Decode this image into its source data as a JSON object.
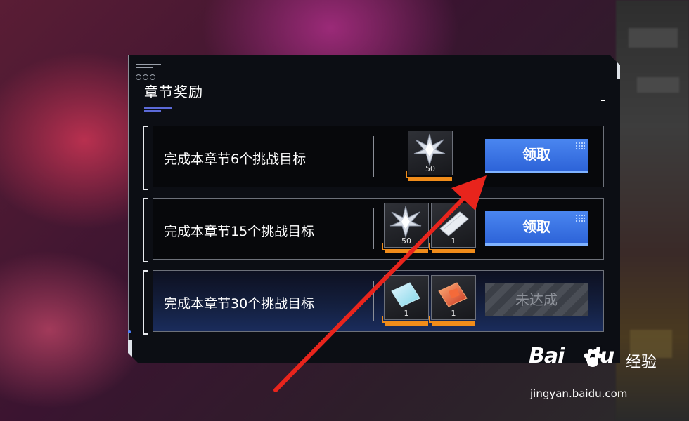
{
  "panel": {
    "title": "章节奖励"
  },
  "rows": [
    {
      "goal": "完成本章节6个挑战目标",
      "items": [
        {
          "icon": "star-crystal-icon",
          "qty": "50"
        }
      ],
      "action": {
        "label": "领取",
        "state": "claimable"
      }
    },
    {
      "goal": "完成本章节15个挑战目标",
      "items": [
        {
          "icon": "star-crystal-icon",
          "qty": "50"
        },
        {
          "icon": "white-ticket-icon",
          "qty": "1"
        }
      ],
      "action": {
        "label": "领取",
        "state": "claimable"
      }
    },
    {
      "goal": "完成本章节30个挑战目标",
      "items": [
        {
          "icon": "cyan-ticket-icon",
          "qty": "1"
        },
        {
          "icon": "red-ticket-icon",
          "qty": "1"
        }
      ],
      "action": {
        "label": "未达成",
        "state": "locked"
      }
    }
  ],
  "colors": {
    "accent_blue": "#3a70e0",
    "item_orange": "#f08c1a",
    "annotation_red": "#e8241c"
  },
  "watermark": {
    "brand": "Bai",
    "brand2": "du",
    "sub": "经验",
    "url": "jingyan.baidu.com"
  }
}
